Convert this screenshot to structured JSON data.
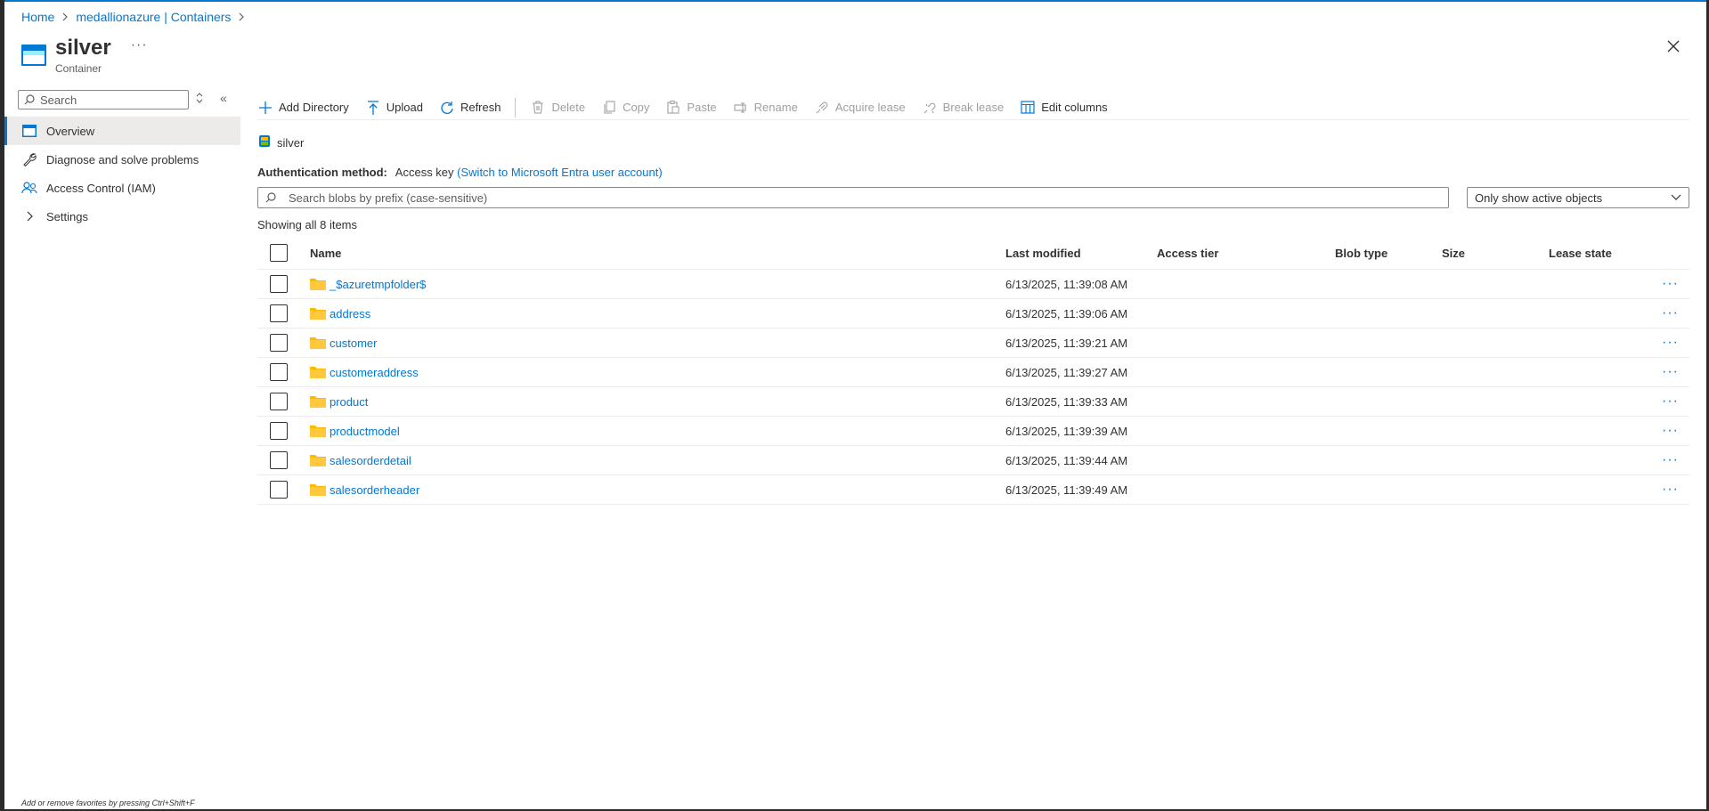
{
  "breadcrumb": {
    "home": "Home",
    "parent": "medallionazure | Containers"
  },
  "header": {
    "title": "silver",
    "subtitle": "Container",
    "more": "···"
  },
  "sidebar": {
    "search_placeholder": "Search",
    "collapse": "«",
    "items": [
      {
        "label": "Overview",
        "icon": "overview-icon"
      },
      {
        "label": "Diagnose and solve problems",
        "icon": "wrench-icon"
      },
      {
        "label": "Access Control (IAM)",
        "icon": "people-icon"
      },
      {
        "label": "Settings",
        "icon": "chevron-right-icon"
      }
    ]
  },
  "toolbar": {
    "add_directory": "Add Directory",
    "upload": "Upload",
    "refresh": "Refresh",
    "delete": "Delete",
    "copy": "Copy",
    "paste": "Paste",
    "rename": "Rename",
    "acquire_lease": "Acquire lease",
    "break_lease": "Break lease",
    "edit_columns": "Edit columns"
  },
  "container_path": "silver",
  "auth": {
    "label": "Authentication method:",
    "value": "Access key",
    "switch_link": "(Switch to Microsoft Entra user account)"
  },
  "blob_search": {
    "placeholder": "Search blobs by prefix (case-sensitive)"
  },
  "filter": {
    "selected": "Only show active objects"
  },
  "showing": "Showing all 8 items",
  "table": {
    "headers": {
      "name": "Name",
      "last_modified": "Last modified",
      "access_tier": "Access tier",
      "blob_type": "Blob type",
      "size": "Size",
      "lease_state": "Lease state"
    },
    "rows": [
      {
        "name": "_$azuretmpfolder$",
        "modified": "6/13/2025, 11:39:08 AM"
      },
      {
        "name": "address",
        "modified": "6/13/2025, 11:39:06 AM"
      },
      {
        "name": "customer",
        "modified": "6/13/2025, 11:39:21 AM"
      },
      {
        "name": "customeraddress",
        "modified": "6/13/2025, 11:39:27 AM"
      },
      {
        "name": "product",
        "modified": "6/13/2025, 11:39:33 AM"
      },
      {
        "name": "productmodel",
        "modified": "6/13/2025, 11:39:39 AM"
      },
      {
        "name": "salesorderdetail",
        "modified": "6/13/2025, 11:39:44 AM"
      },
      {
        "name": "salesorderheader",
        "modified": "6/13/2025, 11:39:49 AM"
      }
    ],
    "more": "···"
  },
  "footer": "Add or remove favorites by pressing Ctrl+Shift+F",
  "colors": {
    "accent": "#0078d4",
    "folder": "#ffb900"
  }
}
